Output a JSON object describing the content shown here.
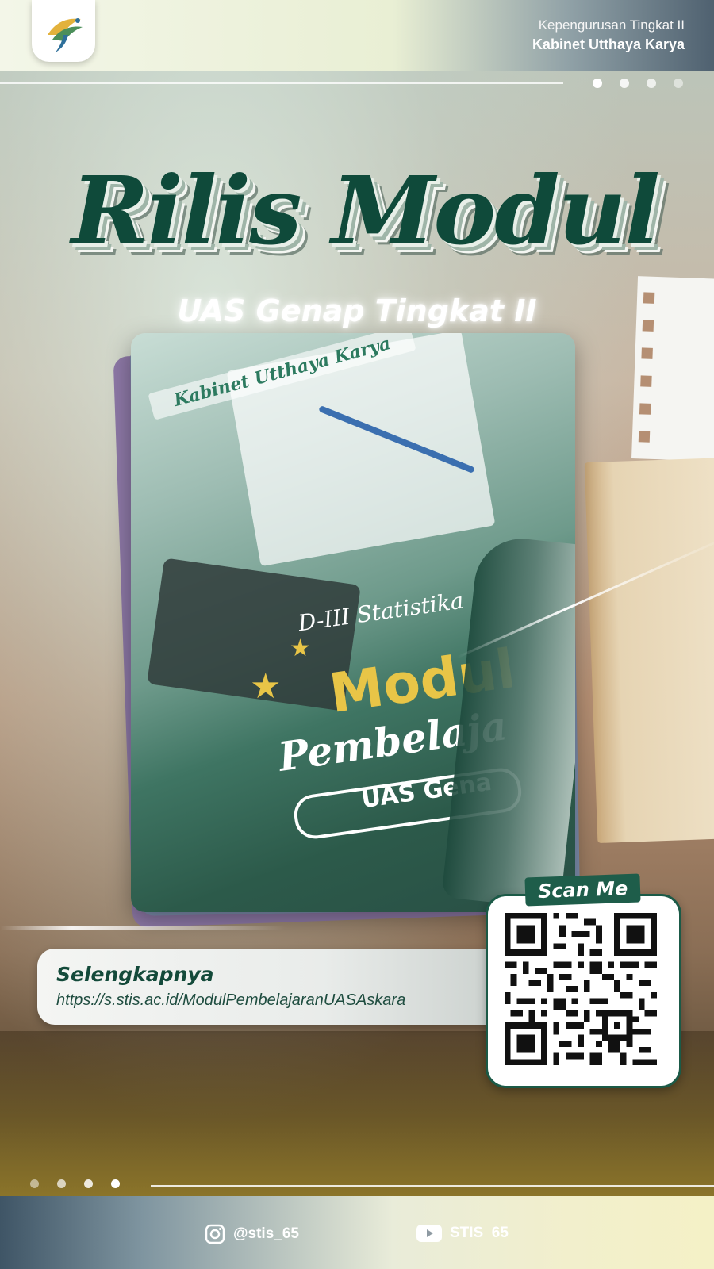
{
  "header": {
    "subtitle": "Kepengurusan Tingkat II",
    "title": "Kabinet Utthaya Karya"
  },
  "hero": {
    "title": "Rilis Modul",
    "subtitle": "UAS Genap Tingkat II"
  },
  "cover": {
    "cabinet": "Kabinet Utthaya Karya",
    "program": "D-III Statistika",
    "word1": "Modul",
    "word2": "Pembelaja",
    "word3": "UAS Gena"
  },
  "link": {
    "heading": "Selengkapnya",
    "url": "https://s.stis.ac.id/ModulPembelajaranUASAskara"
  },
  "qr": {
    "label": "Scan Me"
  },
  "footer": {
    "instagram": "@stis_65",
    "youtube": "STIS  65"
  },
  "colors": {
    "primary_green": "#0f4a3a",
    "accent_yellow": "#e8c547"
  }
}
